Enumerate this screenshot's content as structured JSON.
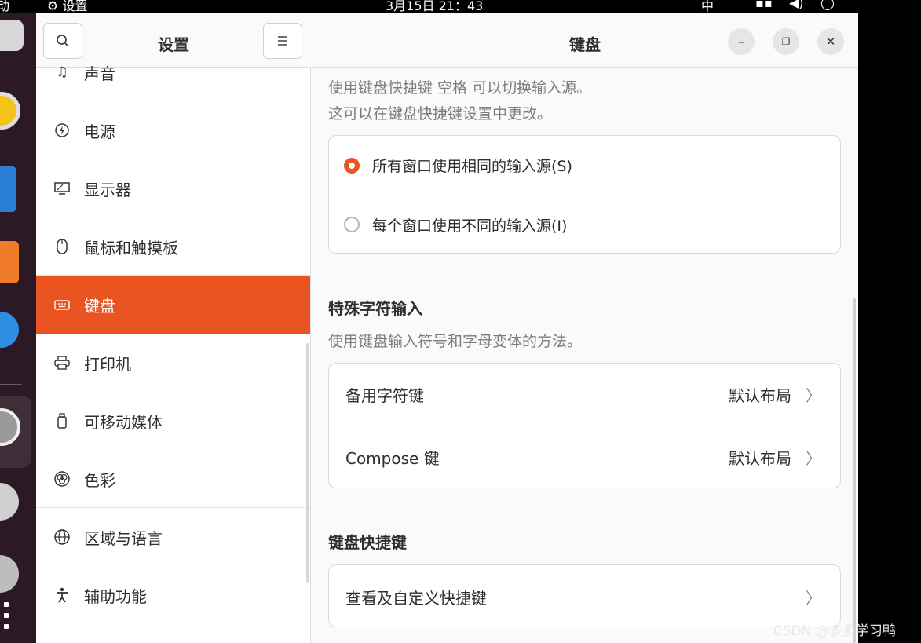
{
  "topbar": {
    "activities": "动",
    "app_menu": "设置",
    "clock": "3月15日  21：43",
    "input_method": "中"
  },
  "sidebar": {
    "title": "设置",
    "items": [
      {
        "label": "声音",
        "icon": "music-note-icon"
      },
      {
        "label": "电源",
        "icon": "power-icon"
      },
      {
        "label": "显示器",
        "icon": "display-icon"
      },
      {
        "label": "鼠标和触摸板",
        "icon": "mouse-icon"
      },
      {
        "label": "键盘",
        "icon": "keyboard-icon"
      },
      {
        "label": "打印机",
        "icon": "printer-icon"
      },
      {
        "label": "可移动媒体",
        "icon": "removable-media-icon"
      },
      {
        "label": "色彩",
        "icon": "color-icon"
      },
      {
        "label": "区域与语言",
        "icon": "globe-icon"
      },
      {
        "label": "辅助功能",
        "icon": "accessibility-icon"
      }
    ],
    "active_index": 4
  },
  "main": {
    "title": "键盘",
    "input_switch_desc1": "使用键盘快捷键 空格 可以切换输入源。",
    "input_switch_desc2": "这可以在键盘快捷键设置中更改。",
    "input_mode": {
      "options": [
        "所有窗口使用相同的输入源(S)",
        "每个窗口使用不同的输入源(I)"
      ],
      "selected": 0
    },
    "special_chars": {
      "title": "特殊字符输入",
      "desc": "使用键盘输入符号和字母变体的方法。",
      "rows": [
        {
          "label": "备用字符键",
          "value": "默认布局"
        },
        {
          "label": "Compose 键",
          "value": "默认布局"
        }
      ]
    },
    "shortcuts": {
      "title": "键盘快捷键",
      "row_label": "查看及自定义快捷键"
    }
  },
  "watermark": "CSDN @多多学习鸭",
  "colors": {
    "accent": "#e95420",
    "dock": "#2b1a25"
  }
}
